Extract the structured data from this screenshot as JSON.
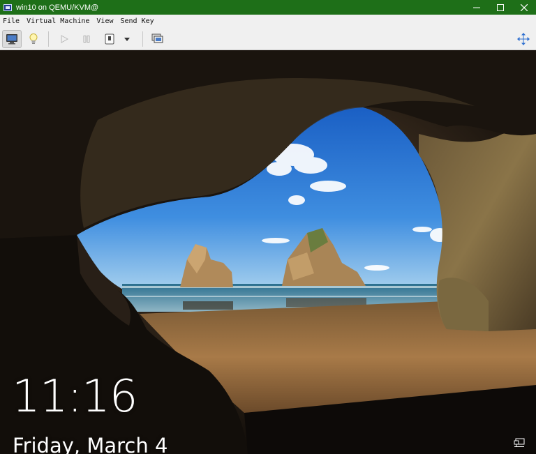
{
  "window": {
    "title": "win10 on QEMU/KVM@",
    "titlebar_color": "#1e6f18",
    "controls": [
      "minimize-icon",
      "maximize-icon",
      "close-icon"
    ]
  },
  "menu": {
    "items": [
      "File",
      "Virtual Machine",
      "View",
      "Send Key"
    ]
  },
  "toolbar": {
    "buttons": [
      {
        "icon": "console-monitor-icon",
        "active": true
      },
      {
        "icon": "details-lightbulb-icon"
      },
      {
        "icon": "run-play-icon",
        "disabled": true
      },
      {
        "icon": "pause-icon",
        "disabled": true
      },
      {
        "icon": "shutdown-icon"
      },
      {
        "icon": "dropdown-arrow-icon"
      },
      {
        "icon": "snapshots-icon"
      },
      {
        "icon": "fullscreen-icon"
      }
    ]
  },
  "lockscreen": {
    "time": "11:16",
    "date": "Friday, March 4",
    "network_icon": "network-icon"
  }
}
